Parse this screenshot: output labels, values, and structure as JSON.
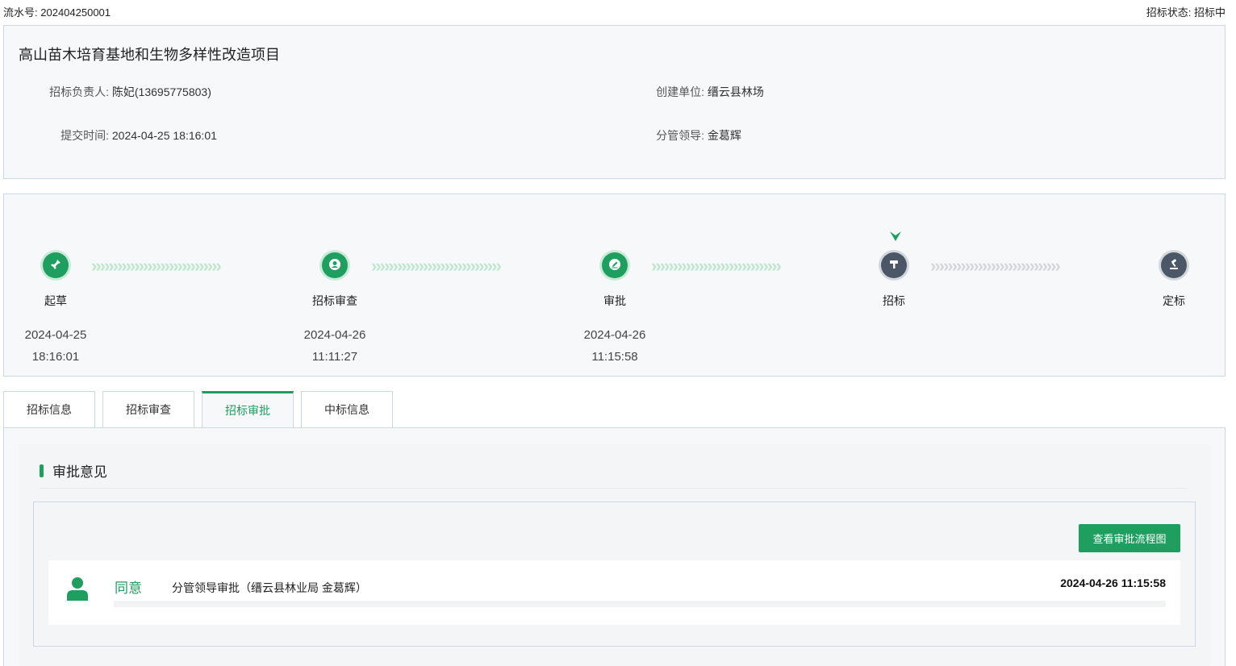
{
  "header": {
    "serial_label": "流水号:",
    "serial_value": "202404250001",
    "status_label": "招标状态:",
    "status_value": "招标中"
  },
  "project": {
    "title": "高山苗木培育基地和生物多样性改造项目",
    "fields": [
      {
        "label": "招标负责人:",
        "value": "陈妃(13695775803)"
      },
      {
        "label": "创建单位:",
        "value": "缙云县林场"
      },
      {
        "label": "提交时间:",
        "value": "2024-04-25 18:16:01"
      },
      {
        "label": "分管领导:",
        "value": "金葛辉"
      }
    ]
  },
  "steps": [
    {
      "name": "起草",
      "date": "2024-04-25",
      "time": "18:16:01",
      "status": "done",
      "icon": "pin-icon"
    },
    {
      "name": "招标审查",
      "date": "2024-04-26",
      "time": "11:11:27",
      "status": "done",
      "icon": "user-icon"
    },
    {
      "name": "审批",
      "date": "2024-04-26",
      "time": "11:15:58",
      "status": "done",
      "icon": "pen-icon"
    },
    {
      "name": "招标",
      "date": "",
      "time": "",
      "status": "current",
      "icon": "hammer-icon"
    },
    {
      "name": "定标",
      "date": "",
      "time": "",
      "status": "todo",
      "icon": "gavel-icon"
    }
  ],
  "tabs": [
    {
      "label": "招标信息",
      "active": false
    },
    {
      "label": "招标审查",
      "active": false
    },
    {
      "label": "招标审批",
      "active": true
    },
    {
      "label": "中标信息",
      "active": false
    }
  ],
  "approval": {
    "section_title": "审批意见",
    "flow_button": "查看审批流程图",
    "records": [
      {
        "result": "同意",
        "desc": "分管领导审批（缙云县林业局  金葛辉）",
        "time": "2024-04-26 11:15:58"
      }
    ]
  },
  "colors": {
    "accent": "#1e9e5f",
    "pending": "#4b5666",
    "border": "#c9d9ea",
    "panel_bg": "#f6f8fa"
  }
}
